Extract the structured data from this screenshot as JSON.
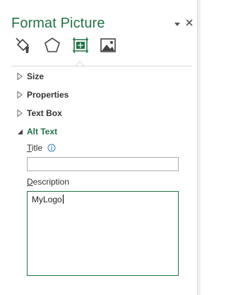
{
  "pane": {
    "title": "Format Picture",
    "pin_icon": "chevron-down-icon",
    "close_icon": "close-icon"
  },
  "tabs": [
    {
      "name": "Fill & Line",
      "icon": "paint-bucket-icon"
    },
    {
      "name": "Effects",
      "icon": "pentagon-icon"
    },
    {
      "name": "Size & Properties",
      "icon": "size-properties-icon",
      "selected": true
    },
    {
      "name": "Picture",
      "icon": "picture-icon"
    }
  ],
  "sections": {
    "size": {
      "label": "Size",
      "expanded": false
    },
    "properties": {
      "label": "Properties",
      "expanded": false
    },
    "text_box": {
      "label": "Text Box",
      "expanded": false
    },
    "alt_text": {
      "label": "Alt Text",
      "expanded": true
    }
  },
  "alt_text": {
    "title_label_key": "T",
    "title_label_rest": "itle",
    "title_value": "",
    "description_label_key": "D",
    "description_label_rest": "escription",
    "description_value": "MyLogo"
  },
  "colors": {
    "accent": "#217346",
    "text": "#333333",
    "border": "#abadb3"
  }
}
